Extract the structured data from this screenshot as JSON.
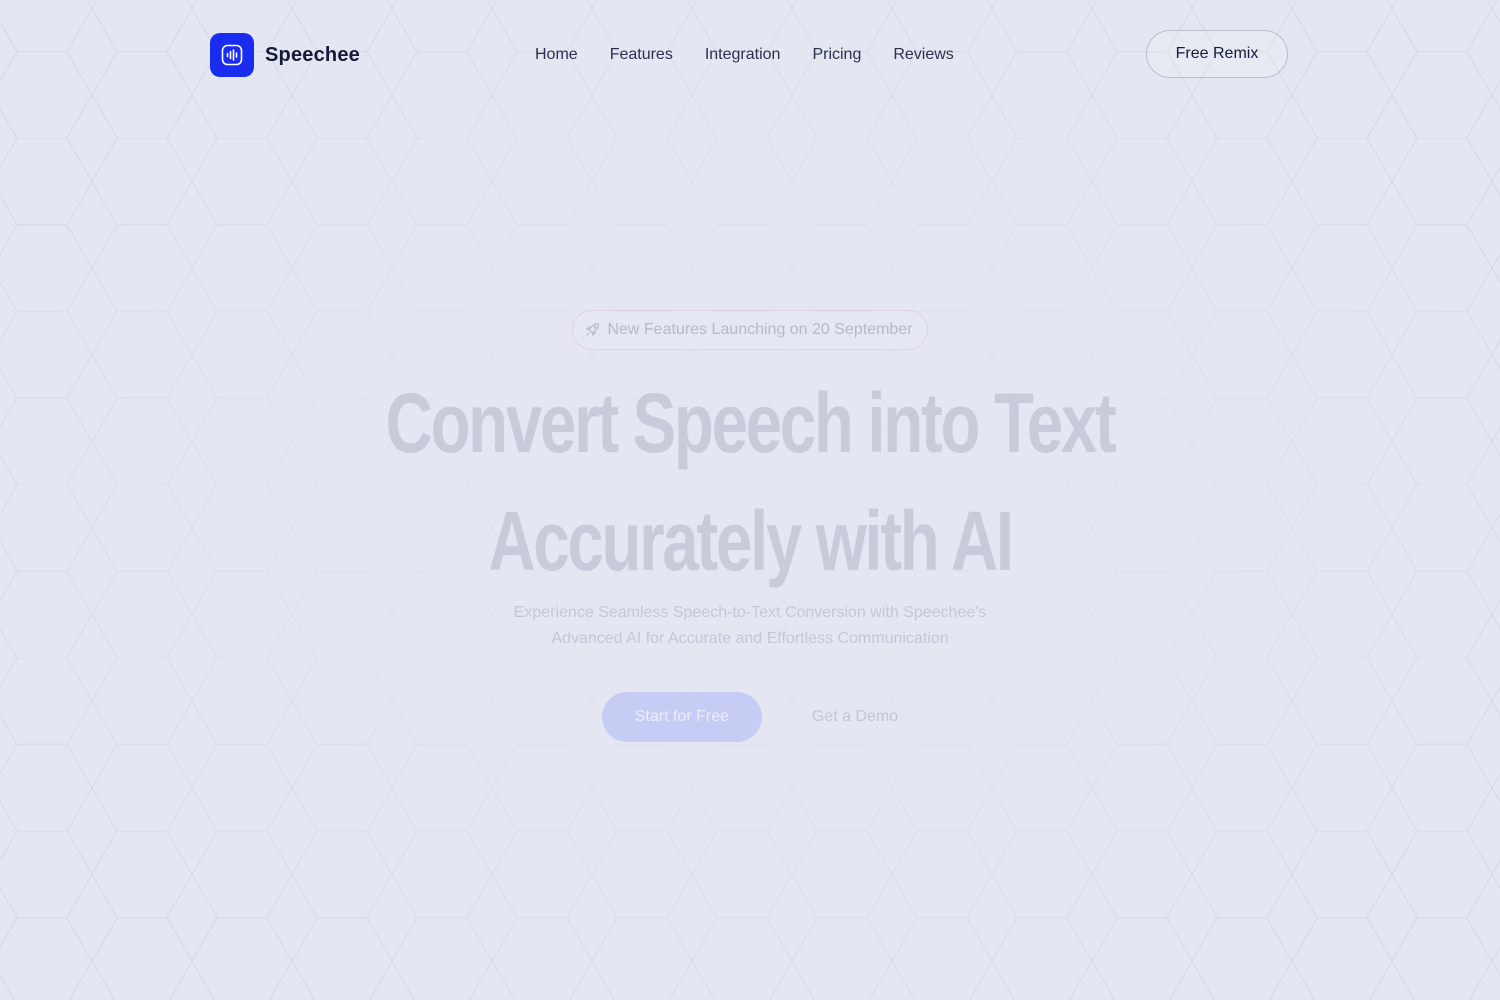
{
  "brand": {
    "name": "Speechee",
    "icon": "sound-wave-icon",
    "accent_color": "#1a2cf0"
  },
  "nav": {
    "items": [
      {
        "label": "Home"
      },
      {
        "label": "Features"
      },
      {
        "label": "Integration"
      },
      {
        "label": "Pricing"
      },
      {
        "label": "Reviews"
      }
    ]
  },
  "header": {
    "cta_label": "Free Remix"
  },
  "hero": {
    "announcement": {
      "icon": "rocket-icon",
      "text": "New Features Launching on 20 September"
    },
    "headline": {
      "line1": "Convert Speech into Text",
      "line2": "Accurately with AI"
    },
    "subtitle": {
      "line1": "Experience Seamless Speech-to-Text Conversion with Speechee's",
      "line2": "Advanced AI for Accurate and Effortless Communication"
    },
    "primary_cta": "Start for Free",
    "secondary_cta": "Get a Demo"
  },
  "colors": {
    "background": "#e4e7f2",
    "text_dark": "#151a3a",
    "headline_faded": "#c8cbda",
    "primary_button_faded": "#c7ccf5"
  }
}
